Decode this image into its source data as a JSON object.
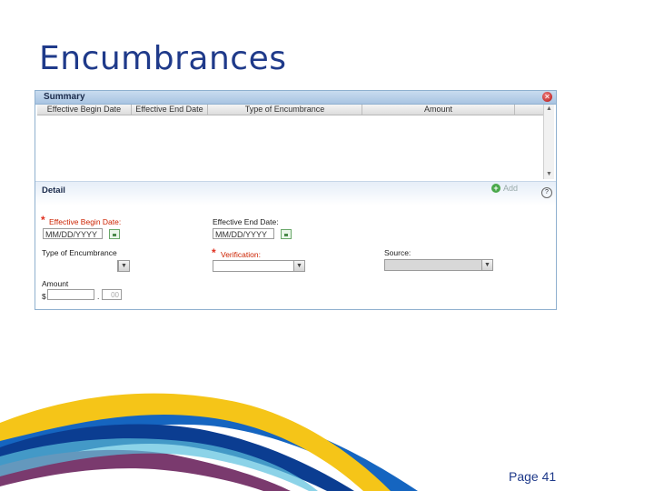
{
  "slide": {
    "title": "Encumbrances",
    "page": "Page 41"
  },
  "summary": {
    "title": "Summary",
    "columns": [
      "Effective Begin Date",
      "Effective End Date",
      "Type of Encumbrance",
      "Amount"
    ]
  },
  "detail": {
    "title": "Detail",
    "add_label": "Add",
    "effective_begin": {
      "label": "Effective Begin Date:",
      "placeholder": "MM/DD/YYYY"
    },
    "effective_end": {
      "label": "Effective End Date:",
      "placeholder": "MM/DD/YYYY"
    },
    "type": {
      "label": "Type of Encumbrance"
    },
    "verification": {
      "label": "Verification:"
    },
    "source": {
      "label": "Source:"
    },
    "amount": {
      "label": "Amount",
      "currency": "$",
      "cents": "00"
    }
  },
  "colors": {
    "title": "#1f3a8a",
    "required": "#cc2200",
    "panel_border": "#8fb0cf"
  },
  "icons": [
    "close-icon",
    "add-icon",
    "help-icon",
    "calendar-icon",
    "chevron-down-icon"
  ]
}
